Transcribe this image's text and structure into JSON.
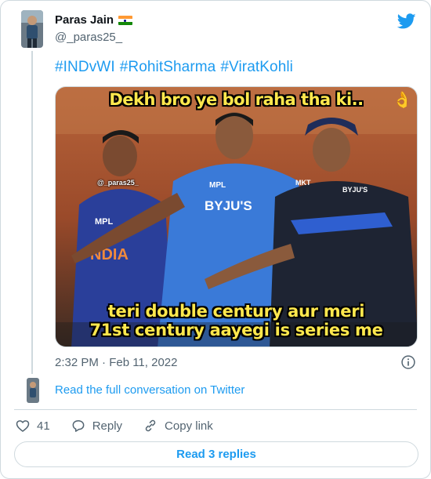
{
  "tweet": {
    "display_name": "Paras Jain",
    "handle": "@_paras25_",
    "flag_icon": "india-flag-icon",
    "hashtags": [
      "#INDvWI",
      "#RohitSharma",
      "#ViratKohli"
    ],
    "media": {
      "caption_top": "Dekh bro ye bol raha tha ki..",
      "caption_bottom_line1": "teri double century aur meri",
      "caption_bottom_line2": "71st century aayegi is series me",
      "watermark": "@_paras25_"
    },
    "timestamp": "2:32 PM · Feb 11, 2022",
    "read_conversation": "Read the full conversation on Twitter",
    "likes": "41",
    "reply_label": "Reply",
    "copy_link_label": "Copy link",
    "read_replies": "Read 3 replies"
  },
  "colors": {
    "accent": "#1d9bf0",
    "text_secondary": "#536471",
    "border": "#cfd9de",
    "caption_yellow": "#ffe84d"
  },
  "icons": [
    "twitter-bird-icon",
    "info-icon",
    "heart-icon",
    "reply-icon",
    "link-icon",
    "ok-hand-emoji"
  ]
}
